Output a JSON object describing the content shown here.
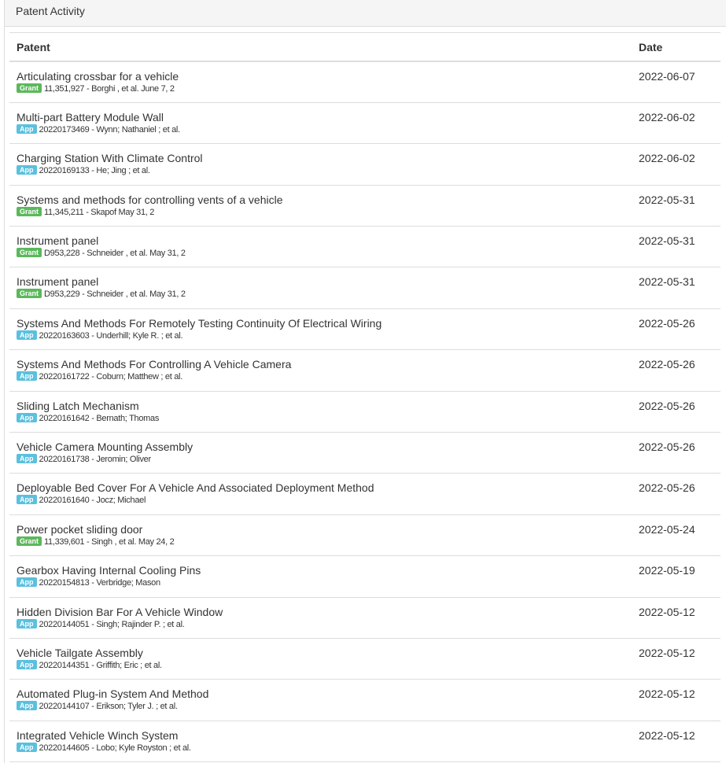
{
  "panel": {
    "title": "Patent Activity"
  },
  "table": {
    "headers": {
      "patent": "Patent",
      "date": "Date"
    },
    "badge_colors": {
      "Grant": "#5cb85c",
      "App": "#5bc0de"
    },
    "rows": [
      {
        "title": "Articulating crossbar for a vehicle",
        "badge": "Grant",
        "meta": "11,351,927 - Borghi , et al. June 7, 2",
        "date": "2022-06-07"
      },
      {
        "title": "Multi-part Battery Module Wall",
        "badge": "App",
        "meta": "20220173469 - Wynn; Nathaniel ;   et al.",
        "date": "2022-06-02"
      },
      {
        "title": "Charging Station With Climate Control",
        "badge": "App",
        "meta": "20220169133 - He; Jing ;   et al.",
        "date": "2022-06-02"
      },
      {
        "title": "Systems and methods for controlling vents of a vehicle",
        "badge": "Grant",
        "meta": "11,345,211 - Skapof May 31, 2",
        "date": "2022-05-31"
      },
      {
        "title": "Instrument panel",
        "badge": "Grant",
        "meta": "D953,228 - Schneider , et al. May 31, 2",
        "date": "2022-05-31"
      },
      {
        "title": "Instrument panel",
        "badge": "Grant",
        "meta": "D953,229 - Schneider , et al. May 31, 2",
        "date": "2022-05-31"
      },
      {
        "title": "Systems And Methods For Remotely Testing Continuity Of Electrical Wiring",
        "badge": "App",
        "meta": "20220163603 - Underhill; Kyle R. ;   et al.",
        "date": "2022-05-26"
      },
      {
        "title": "Systems And Methods For Controlling A Vehicle Camera",
        "badge": "App",
        "meta": "20220161722 - Coburn; Matthew ;   et al.",
        "date": "2022-05-26"
      },
      {
        "title": "Sliding Latch Mechanism",
        "badge": "App",
        "meta": "20220161642 - Bernath; Thomas",
        "date": "2022-05-26"
      },
      {
        "title": "Vehicle Camera Mounting Assembly",
        "badge": "App",
        "meta": "20220161738 - Jeromin; Oliver",
        "date": "2022-05-26"
      },
      {
        "title": "Deployable Bed Cover For A Vehicle And Associated Deployment Method",
        "badge": "App",
        "meta": "20220161640 - Jocz; Michael",
        "date": "2022-05-26"
      },
      {
        "title": "Power pocket sliding door",
        "badge": "Grant",
        "meta": "11,339,601 - Singh , et al. May 24, 2",
        "date": "2022-05-24"
      },
      {
        "title": "Gearbox Having Internal Cooling Pins",
        "badge": "App",
        "meta": "20220154813 - Verbridge; Mason",
        "date": "2022-05-19"
      },
      {
        "title": "Hidden Division Bar For A Vehicle Window",
        "badge": "App",
        "meta": "20220144051 - Singh; Rajinder P. ;   et al.",
        "date": "2022-05-12"
      },
      {
        "title": "Vehicle Tailgate Assembly",
        "badge": "App",
        "meta": "20220144351 - Griffith; Eric ;   et al.",
        "date": "2022-05-12"
      },
      {
        "title": "Automated Plug-in System And Method",
        "badge": "App",
        "meta": "20220144107 - Erikson; Tyler J. ;   et al.",
        "date": "2022-05-12"
      },
      {
        "title": "Integrated Vehicle Winch System",
        "badge": "App",
        "meta": "20220144605 - Lobo; Kyle Royston ;   et al.",
        "date": "2022-05-12"
      }
    ]
  }
}
